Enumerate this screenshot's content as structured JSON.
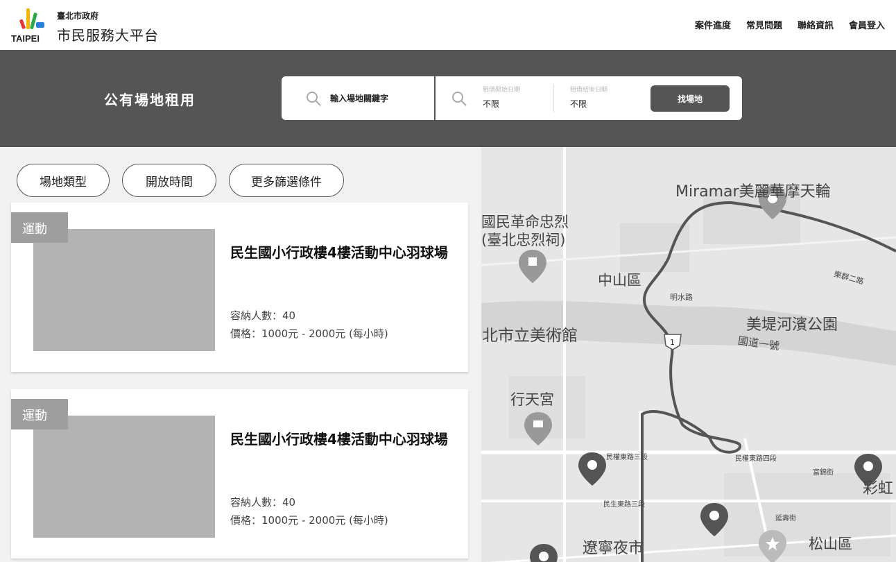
{
  "header": {
    "logo_word": "TAIPEI",
    "org_name": "臺北市政府",
    "platform_name": "市民服務大平台",
    "nav": [
      "案件進度",
      "常見問題",
      "聯絡資訊",
      "會員登入"
    ]
  },
  "search": {
    "page_title": "公有場地租用",
    "keyword_placeholder": "輸入場地關鍵字",
    "start_date_label": "租借開始日期",
    "start_date_value": "不限",
    "end_date_label": "租借結束日期",
    "end_date_value": "不限",
    "find_button": "找場地"
  },
  "filters": [
    "場地類型",
    "開放時間",
    "更多篩選條件"
  ],
  "venues": [
    {
      "tag": "運動",
      "title": "民生國小行政樓4樓活動中心羽球場",
      "capacity": "容納人數：40",
      "price": "價格：1000元 - 2000元 (每小時)"
    },
    {
      "tag": "運動",
      "title": "民生國小行政樓4樓活動中心羽球場",
      "capacity": "容納人數：40",
      "price": "價格：1000元 - 2000元 (每小時)"
    }
  ],
  "map": {
    "labels": {
      "miramar": "Miramar美麗華摩天輪",
      "martyrs1": "國民革命忠烈",
      "martyrs2": "(臺北忠烈祠)",
      "zhongshan": "中山區",
      "mingshui": "明水路",
      "dazhi": "樂群二路",
      "meiti": "美堤河濱公園",
      "guodao": "國道一號",
      "museum": "臺北市立美術館",
      "xingtian": "行天宮",
      "minquan3": "民權東路三段",
      "minquan4": "民權東路四段",
      "minsheng3": "民生東路三段",
      "fujin": "富錦街",
      "yanshou": "延壽街",
      "songshan": "松山區",
      "liaoning": "遼寧夜市",
      "caihong": "彩虹"
    }
  }
}
